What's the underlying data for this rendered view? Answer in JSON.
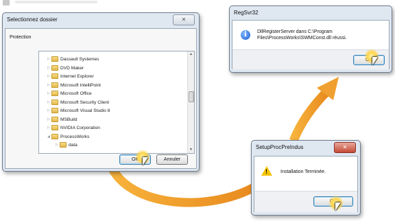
{
  "select_folder_dialog": {
    "title": "Selectionnez dossier",
    "close_label": "✕",
    "description": "Protection",
    "folders": [
      {
        "label": "Dassault Systemes",
        "expanded": false
      },
      {
        "label": "DVD Maker",
        "expanded": false
      },
      {
        "label": "Internet Explorer",
        "expanded": false
      },
      {
        "label": "Microsoft IntelliPoint",
        "expanded": false
      },
      {
        "label": "Microsoft Office",
        "expanded": false
      },
      {
        "label": "Microsoft Security Client",
        "expanded": false
      },
      {
        "label": "Microsoft Visual Studio 8",
        "expanded": false
      },
      {
        "label": "MSBuild",
        "expanded": false
      },
      {
        "label": "NVIDIA Corporation",
        "expanded": false
      },
      {
        "label": "ProcessWorks",
        "expanded": true
      },
      {
        "label": "data",
        "expanded": false
      }
    ],
    "ok_label": "OK",
    "cancel_label": "Annuler"
  },
  "regsvr_dialog": {
    "title": "RegSvr32",
    "icon": "info-icon",
    "message_line1": "DllRegisterServer dans C:\\Program",
    "message_line2": "Files\\ProcessWorks\\SWMConst.dll réussi.",
    "ok_label": "OK"
  },
  "setup_dialog": {
    "title": "SetupProcPreIndus",
    "close_label": "✕",
    "icon": "warning-icon",
    "message": "Installation Terminée.",
    "ok_label": "OK"
  },
  "colors": {
    "arrow": "#f0a030",
    "window_frame": "#dfe7f1",
    "close_red": "#c54a35"
  }
}
